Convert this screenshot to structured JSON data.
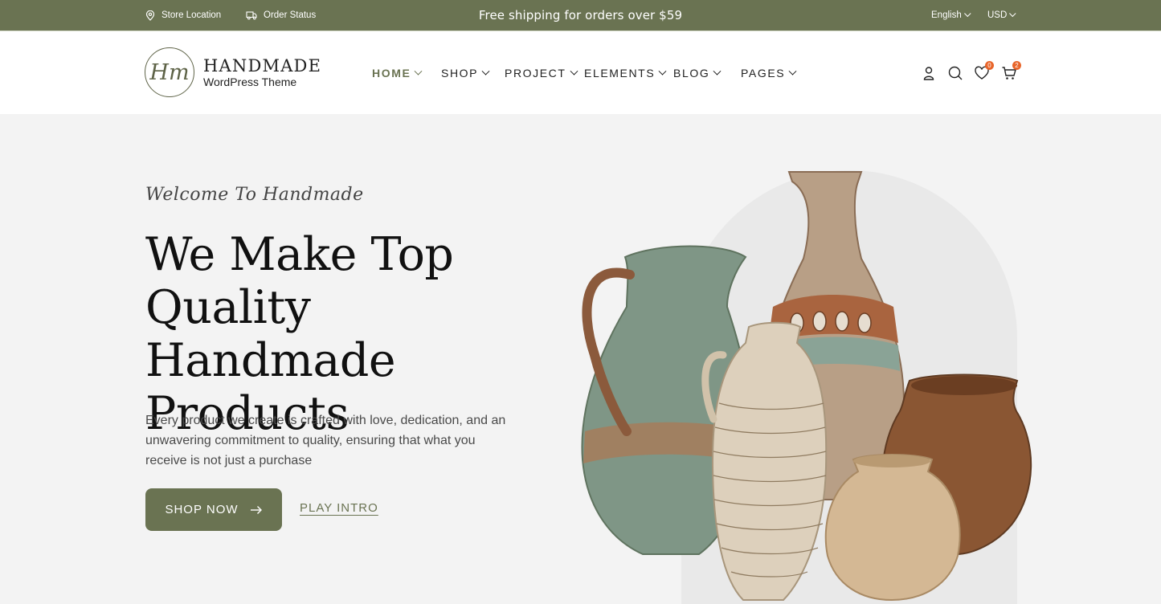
{
  "topbar": {
    "store_location": "Store Location",
    "order_status": "Order Status",
    "announcement": "Free shipping for orders over $59",
    "language": "English",
    "currency": "USD"
  },
  "header": {
    "logo_mark": "Hm",
    "logo_title": "HANDMADE",
    "logo_subtitle": "WordPress Theme",
    "nav": [
      {
        "label": "HOME",
        "active": true
      },
      {
        "label": "SHOP"
      },
      {
        "label": "PROJECT"
      },
      {
        "label": "ELEMENTS"
      },
      {
        "label": "BLOG"
      },
      {
        "label": "PAGES"
      }
    ],
    "wishlist_count": "0",
    "cart_count": "2"
  },
  "hero": {
    "welcome": "Welcome To Handmade",
    "headline": "We Make Top Quality Handmade Products",
    "description": "Every product we create is crafted with love, dedication, and an unwavering commitment to quality, ensuring that what you receive is not just a purchase",
    "shop_button": "SHOP NOW",
    "play_button": "PLAY INTRO"
  },
  "colors": {
    "brand": "#6a7352",
    "badge": "#e8652a",
    "hero_bg": "#f3f3f3"
  },
  "icons": [
    "location-pin-icon",
    "truck-icon",
    "user-icon",
    "search-icon",
    "heart-icon",
    "cart-icon",
    "arrow-right-icon",
    "chevron-down-icon"
  ]
}
